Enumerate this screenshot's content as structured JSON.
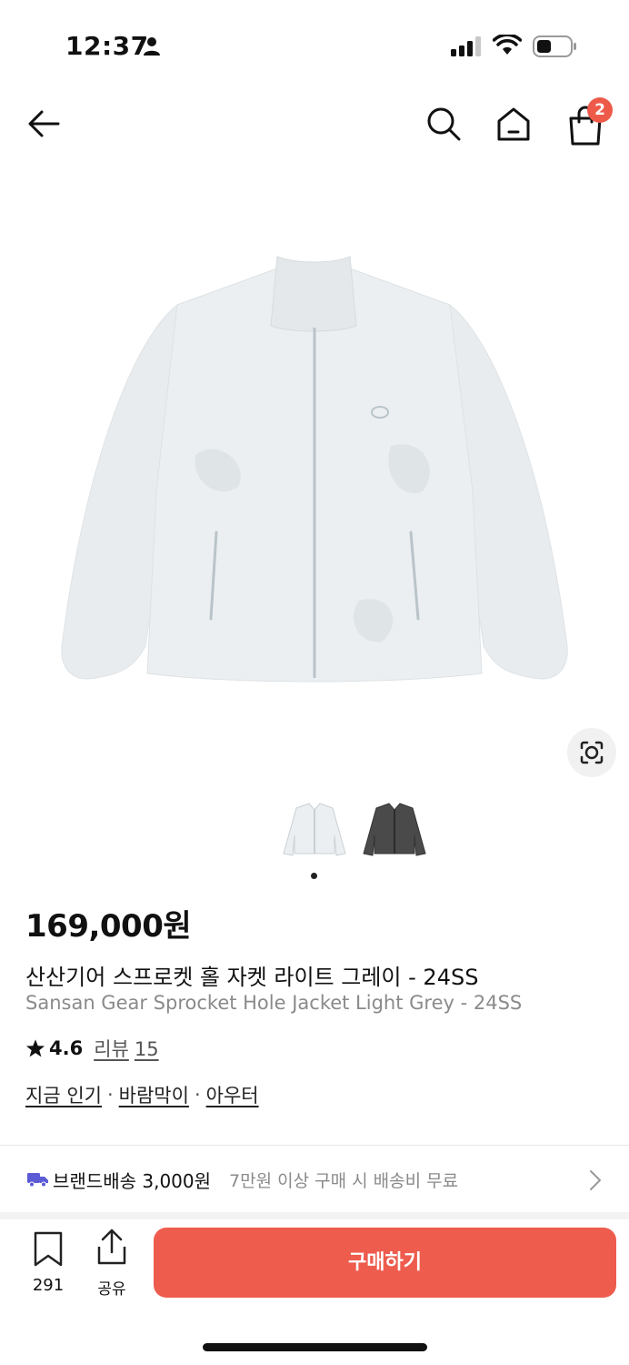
{
  "status_bar": {
    "time": "12:37",
    "icons": [
      "person-icon",
      "signal-icon",
      "wifi-icon",
      "battery-icon"
    ]
  },
  "nav": {
    "icons": [
      "back-arrow-icon",
      "search-icon",
      "home-icon",
      "shopping-bag-icon"
    ],
    "cart_badge": "2"
  },
  "colors": {
    "accent": "#ee5c4e",
    "badge": "#ee5a4a",
    "shipping_icon": "#5b5bd6",
    "muted_text": "#8a8a8a"
  },
  "product": {
    "price": "169,000원",
    "title_ko": "산산기어 스프로켓 홀 자켓 라이트 그레이 - 24SS",
    "title_en": "Sansan Gear Sprocket Hole Jacket Light Grey - 24SS",
    "rating": "4.6",
    "review_label": "리뷰",
    "review_count": "15",
    "tags": [
      "지금 인기",
      "바람막이",
      "아우터"
    ],
    "tag_separator": "·",
    "image_count": 2,
    "current_image": 1
  },
  "shipping": {
    "label": "브랜드배송",
    "fee": "3,000원",
    "note": "7만원 이상 구매 시 배송비 무료"
  },
  "bottom_bar": {
    "bookmark_count": "291",
    "share_label": "공유",
    "buy_label": "구매하기"
  }
}
